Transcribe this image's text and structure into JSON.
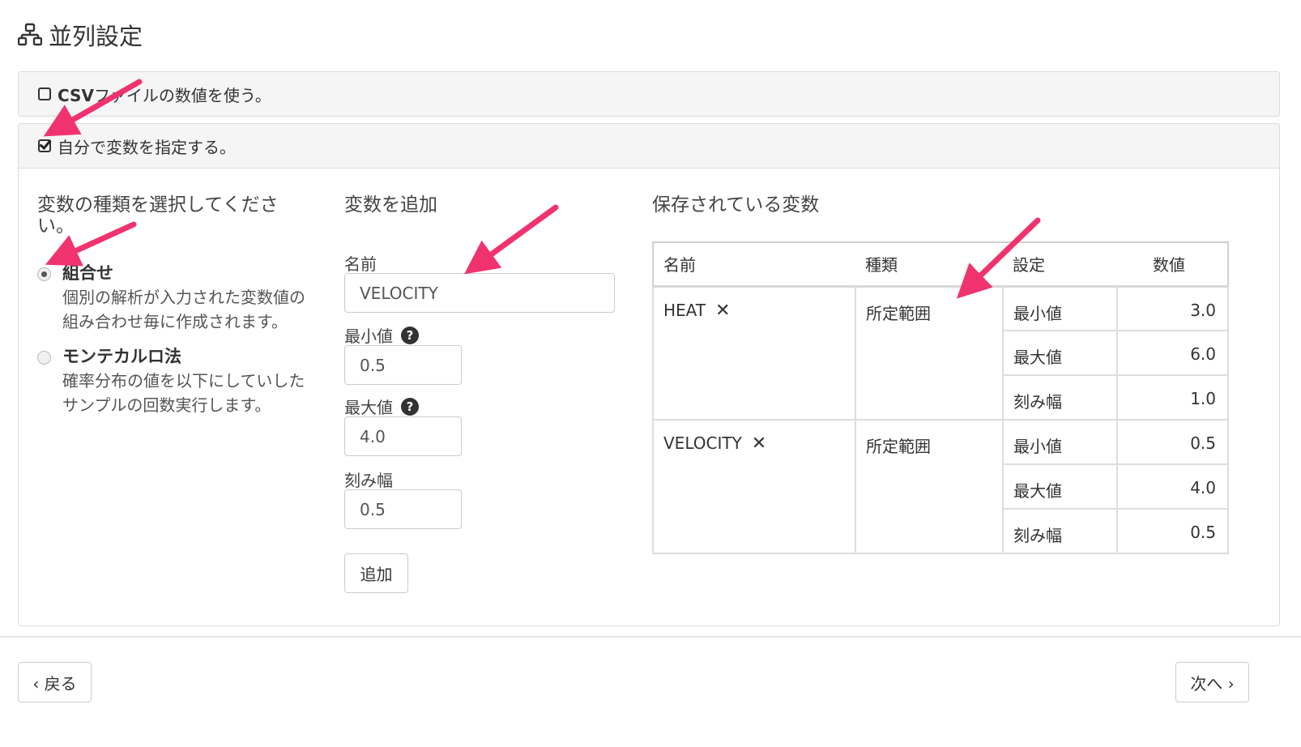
{
  "header": {
    "title": "並列設定",
    "icon": "sitemap-icon"
  },
  "panels": {
    "csv": {
      "label": "CSVファイルの数値を使う。",
      "bold_prefix": "CSV",
      "rest": "ファイルの数値を使う。",
      "checked": false
    },
    "manual": {
      "label": "自分で変数を指定する。",
      "checked": true
    }
  },
  "type_section": {
    "title": "変数の種類を選択してください。",
    "options": [
      {
        "label": "組合せ",
        "desc": "個別の解析が入力された変数値の組み合わせ毎に作成されます。",
        "selected": true
      },
      {
        "label": "モンテカルロ法",
        "desc": "確率分布の値を以下にしていしたサンプルの回数実行します。",
        "selected": false
      }
    ]
  },
  "add_section": {
    "title": "変数を追加",
    "name_label": "名前",
    "name_value": "VELOCITY",
    "min_label": "最小値",
    "min_value": "0.5",
    "max_label": "最大値",
    "max_value": "4.0",
    "step_label": "刻み幅",
    "step_value": "0.5",
    "add_button": "追加",
    "help_glyph": "?"
  },
  "saved_section": {
    "title": "保存されている変数",
    "columns": [
      "名前",
      "種類",
      "設定",
      "数値"
    ],
    "rows": [
      {
        "name": "HEAT",
        "type": "所定範囲",
        "settings": [
          [
            "最小値",
            "3.0"
          ],
          [
            "最大値",
            "6.0"
          ],
          [
            "刻み幅",
            "1.0"
          ]
        ]
      },
      {
        "name": "VELOCITY",
        "type": "所定範囲",
        "settings": [
          [
            "最小値",
            "0.5"
          ],
          [
            "最大値",
            "4.0"
          ],
          [
            "刻み幅",
            "0.5"
          ]
        ]
      }
    ],
    "delete_glyph": "✕"
  },
  "footer": {
    "back": "‹ 戻る",
    "next": "次へ ›"
  },
  "colors": {
    "annotation_arrow": "#f0336e",
    "panel_bg": "#f5f5f5",
    "border": "#dcdcdc"
  }
}
